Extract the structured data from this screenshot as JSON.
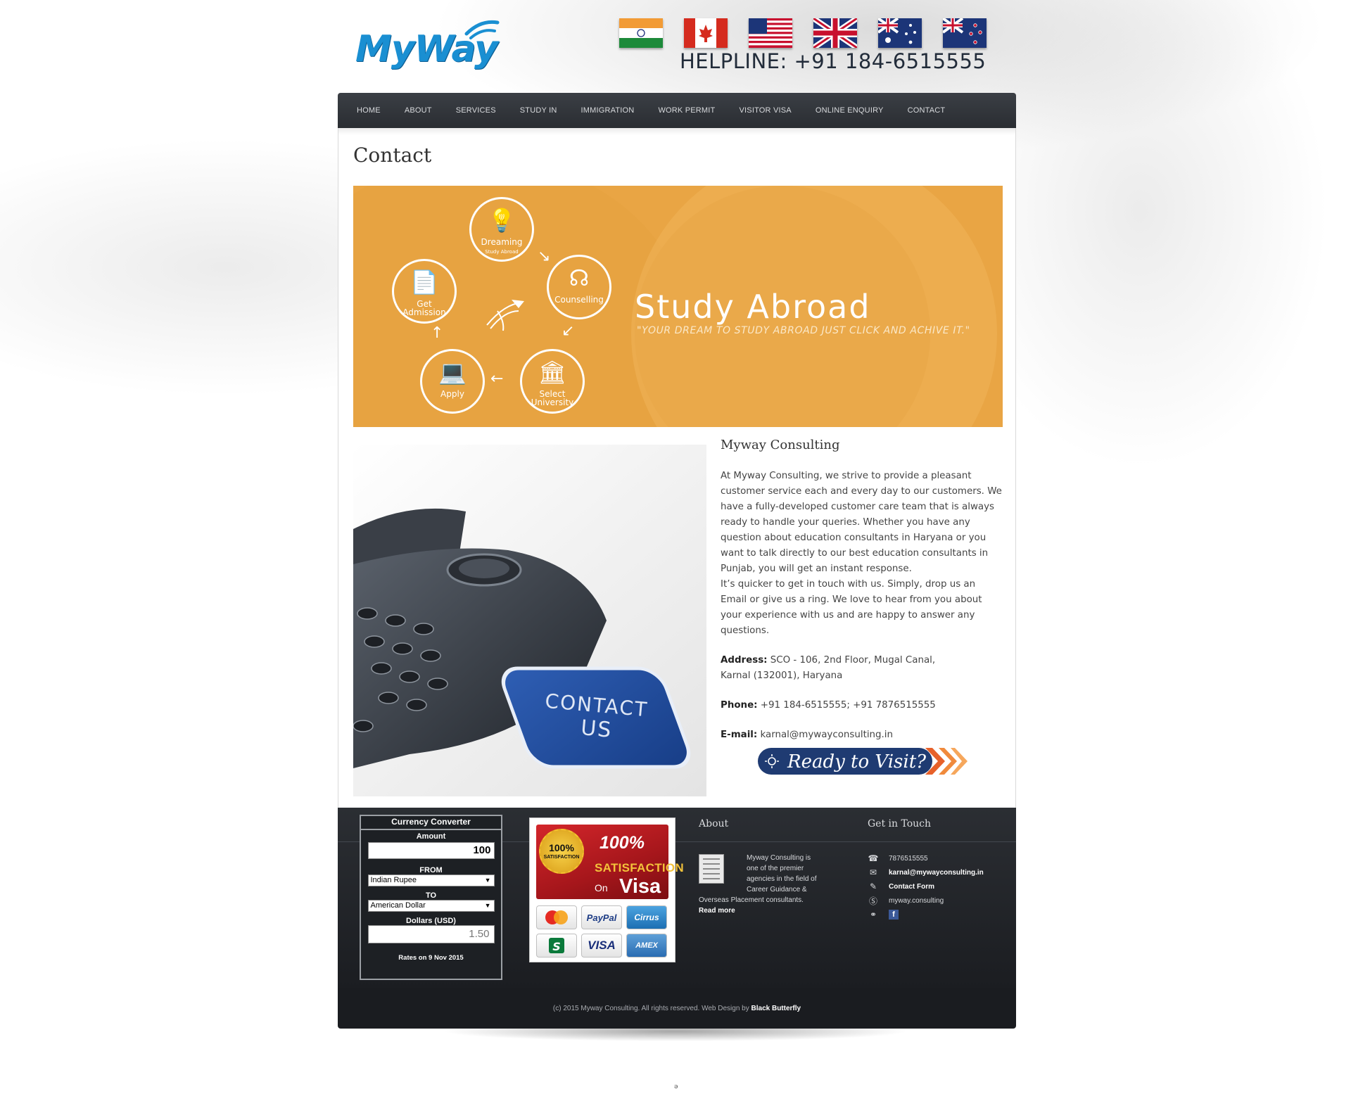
{
  "header": {
    "logo_text": "MyWay",
    "helpline": "HELPLINE: +91 184-6515555",
    "flags": [
      {
        "country": "India"
      },
      {
        "country": "Canada"
      },
      {
        "country": "USA"
      },
      {
        "country": "UK"
      },
      {
        "country": "Australia"
      },
      {
        "country": "New Zealand"
      }
    ]
  },
  "nav": {
    "items": [
      "HOME",
      "ABOUT",
      "SERVICES",
      "STUDY IN",
      "IMMIGRATION",
      "WORK PERMIT",
      "VISITOR VISA",
      "ONLINE ENQUIRY",
      "CONTACT"
    ]
  },
  "page": {
    "title": "Contact"
  },
  "banner": {
    "title": "Study Abroad",
    "tagline": "\"YOUR DREAM TO STUDY ABROAD JUST CLICK AND ACHIVE IT.\"",
    "steps": {
      "dreaming": "Dreaming",
      "dreaming_sub": "Study Abroad",
      "counselling": "Counselling",
      "select": "Select",
      "university": "University",
      "apply": "Apply",
      "get": "Get",
      "admission": "Admission"
    },
    "colors": {
      "background": "#e9a544",
      "text": "#ffffff"
    }
  },
  "photo": {
    "sign_line1": "CONTACT",
    "sign_line2": "US"
  },
  "info": {
    "heading": "Myway Consulting",
    "para1": "At Myway Consulting, we strive to provide a pleasant customer service each and every day to our customers. We have a fully-developed customer care team that is always ready to handle your queries. Whether you have any question about education consultants in Haryana or you want to talk directly to our best education consultants in Punjab, you will get an instant response.",
    "para2": "It’s quicker to get in touch with us. Simply, drop us an Email or give us a ring. We love to hear from you about your experience with us and are happy to answer any questions.",
    "address_label": "Address:",
    "address_line1": "SCO - 106, 2nd Floor, Mugal Canal,",
    "address_line2": "Karnal (132001), Haryana",
    "phone_label": "Phone:",
    "phone": "+91 184-6515555; +91 7876515555",
    "email_label": "E-mail:",
    "email": "karnal@mywayconsulting.in",
    "visit_button": "Ready to Visit?"
  },
  "converter": {
    "title": "Currency Converter",
    "amount_label": "Amount",
    "amount": "100",
    "from_label": "FROM",
    "from": "Indian Rupee",
    "to_label": "TO",
    "to": "American Dollar",
    "result_label": "Dollars (USD)",
    "result": "1.50",
    "rates_note": "Rates on 9 Nov 2015"
  },
  "satisfaction": {
    "seal_pct": "100%",
    "seal_text": "SATISFACTION",
    "pct": "100%",
    "word": "SATISFACTION",
    "on": "On",
    "visa": "Visa",
    "cards": [
      "MASTERCARD",
      "PayPal",
      "Cirrus",
      "Maestro",
      "VISA",
      "AMEX"
    ]
  },
  "footer": {
    "about_heading": "About",
    "about_text_1": "Myway Consulting is",
    "about_text_2": "one of the premier",
    "about_text_3": "agencies in the field of",
    "about_text_4": "Career Guidance &",
    "about_text_5": "Overseas Placement consultants.",
    "read_more": "Read more",
    "touch_heading": "Get in Touch",
    "touch_phone": "7876515555",
    "touch_email": "karnal@mywayconsulting.in",
    "touch_form": "Contact Form",
    "touch_skype": "myway.consulting",
    "fb": "f",
    "copyright": "(c) 2015 Myway Consulting. All rights reserved. Web Design by",
    "credit": "Black Butterfly"
  }
}
